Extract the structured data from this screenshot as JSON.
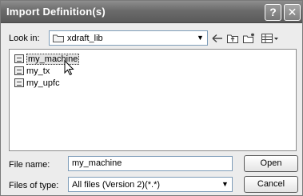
{
  "window": {
    "title": "Import Definition(s)",
    "help_glyph": "?",
    "close_glyph": "✕"
  },
  "toolbar": {
    "lookin_label": "Look in:",
    "lookin_value": "xdraft_lib",
    "back_icon": "back-arrow-icon",
    "up_icon": "up-folder-icon",
    "new_icon": "new-folder-icon",
    "view_icon": "view-menu-icon"
  },
  "files": [
    {
      "name": "my_machine",
      "selected": true
    },
    {
      "name": "my_tx",
      "selected": false
    },
    {
      "name": "my_upfc",
      "selected": false
    }
  ],
  "form": {
    "filename_label": "File name:",
    "filename_value": "my_machine",
    "filetype_label": "Files of type:",
    "filetype_value": "All files (Version 2)(*.*)"
  },
  "buttons": {
    "open": "Open",
    "cancel": "Cancel"
  }
}
